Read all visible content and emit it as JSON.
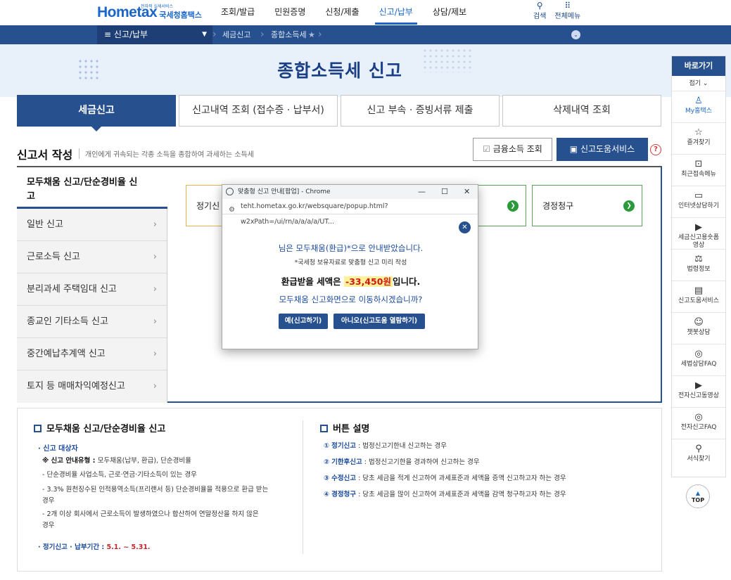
{
  "header": {
    "logo_tiny": "전자적 실세서비스",
    "logo_main": "Hometax",
    "logo_sub": "국세청홈택스",
    "nav": [
      "조회/발급",
      "민원증명",
      "신청/제출",
      "신고/납부",
      "상담/제보"
    ],
    "active_nav": "신고/납부",
    "search_label": "검색",
    "menu_label": "전체메뉴"
  },
  "subbar": {
    "menu_label": "≡  신고/납부",
    "crumbs": [
      "세금신고",
      "종합소득세"
    ]
  },
  "banner": {
    "title": "종합소득세 신고"
  },
  "tabs": [
    "세금신고",
    "신고내역 조회 (접수증 · 납부서)",
    "신고 부속 · 증빙서류 제출",
    "삭제내역 조회"
  ],
  "section": {
    "title": "신고서 작성",
    "desc": "개인에게 귀속되는 각종 소득을 종합하여 과세하는 소득세",
    "fin_btn": "금융소득 조회",
    "help_btn": "신고도움서비스",
    "q": "?"
  },
  "left_menu": {
    "active": "모두채움 신고/단순경비율 신고",
    "items": [
      "일반 신고",
      "근로소득 신고",
      "분리과세 주택임대 신고",
      "종교인 기타소득 신고",
      "중간예납추계액 신고",
      "토지 등 매매차익예정신고"
    ]
  },
  "choices": {
    "first": "정기신",
    "last": "경정청구"
  },
  "popup": {
    "window_title": "맞춤형 신고 안내[팝업] - Chrome",
    "url": "teht.hometax.go.kr/websquare/popup.html?w2xPath=/ui/rn/a/a/a/a/UT...",
    "line1": "님은 모두채움(환급)*으로 안내받았습니다.",
    "line2": "*국세청 보유자료로 맞춤형 신고 미리 작성",
    "line3_pre": "환급받을 세액은 ",
    "amount": "-33,450원",
    "line3_post": "입니다.",
    "line4": "모두채움 신고화면으로 이동하시겠습니까?",
    "yes_btn": "예(신고하기)",
    "no_btn": "아니오(신고도움 열람하기)"
  },
  "lower": {
    "left_title": "모두채움 신고/단순경비율 신고",
    "target_label": "· 신고 대상자",
    "type_label": "※ 신고 안내유형 : ",
    "type_value": "모두채움(납부, 환급), 단순경비율",
    "items": [
      "- 단순경비율 사업소득, 근로·연금·기타소득이 있는 경우",
      "- 3.3% 원천징수된 인적용역소득(프리랜서 등) 단순경비율을 적용으로 환급 받는",
      "  경우",
      "- 2개 이상 회사에서 근로소득이 발생하였으나 합산하여 연말정산을 하지 않은",
      "  경우"
    ],
    "period_label": "· 정기신고 · 납부기간 : ",
    "period_value": "5.1. ~ 5.31.",
    "right_title": "버튼 설명",
    "buttons": [
      {
        "num": "①",
        "name": "정기신고",
        "desc": " : 법정신고기한내 신고하는 경우"
      },
      {
        "num": "②",
        "name": "기한후신고",
        "desc": " : 법정신고기한을 경과하여 신고하는 경우"
      },
      {
        "num": "③",
        "name": "수정신고",
        "desc": " : 당초 세금을 적게 신고하여 과세표준과 세액을 증액 신고하고자 하는 경우"
      },
      {
        "num": "④",
        "name": "경정청구",
        "desc": " : 당초 세금을 많이 신고하여 과세표준과 세액을 감액 청구하고자 하는 경우"
      }
    ]
  },
  "quick": {
    "head": "바로가기",
    "fold": "접기 ⌄",
    "items": [
      "My홈택스",
      "즐겨찾기",
      "최근접속메뉴",
      "인터넷상담하기",
      "세금신고용숏폼영상",
      "법령정보",
      "신고도움서비스",
      "챗봇상담",
      "세법상담FAQ",
      "전자신고동영상",
      "전자신고FAQ",
      "서식찾기"
    ],
    "top": "TOP"
  }
}
